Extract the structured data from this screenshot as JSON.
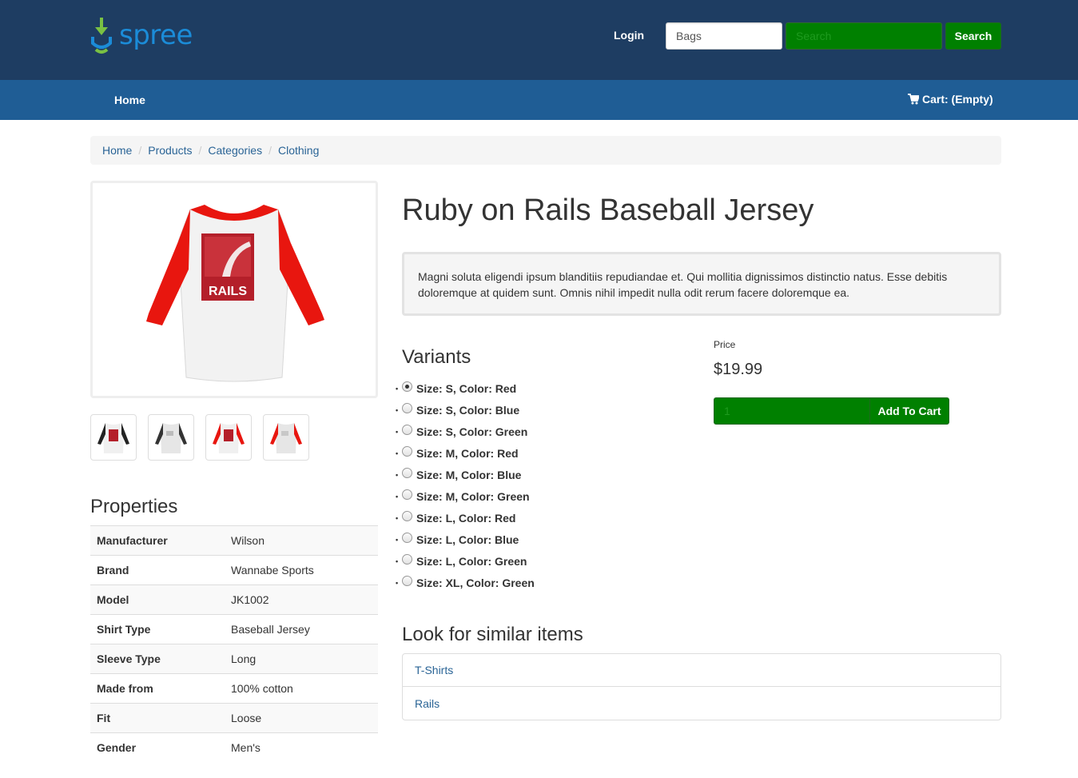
{
  "header": {
    "logo_text": "spree",
    "login_label": "Login",
    "taxon_select_value": "Bags",
    "search_placeholder": "Search",
    "search_button_label": "Search",
    "accent_color": "#008000",
    "header_color": "#1e3d62",
    "nav_color": "#1f5d95"
  },
  "nav": {
    "home_label": "Home",
    "cart_label": "Cart: (Empty)",
    "cart_icon": "cart-icon"
  },
  "breadcrumb": [
    "Home",
    "Products",
    "Categories",
    "Clothing"
  ],
  "product": {
    "title": "Ruby on Rails Baseball Jersey",
    "description": "Magni soluta eligendi ipsum blanditiis repudiandae et. Qui mollitia dignissimos distinctio natus. Esse debitis doloremque at quidem sunt. Omnis nihil impedit nulla odit rerum facere doloremque ea.",
    "image_logo_text": "RAILS"
  },
  "thumbnails": [
    {
      "sleeve_color": "#222222",
      "variant": "black"
    },
    {
      "sleeve_color": "#333333",
      "variant": "black-gray"
    },
    {
      "sleeve_color": "#e01010",
      "variant": "red"
    },
    {
      "sleeve_color": "#e01010",
      "variant": "red-gray"
    }
  ],
  "properties": {
    "title": "Properties",
    "rows": [
      {
        "key": "Manufacturer",
        "value": "Wilson"
      },
      {
        "key": "Brand",
        "value": "Wannabe Sports"
      },
      {
        "key": "Model",
        "value": "JK1002"
      },
      {
        "key": "Shirt Type",
        "value": "Baseball Jersey"
      },
      {
        "key": "Sleeve Type",
        "value": "Long"
      },
      {
        "key": "Made from",
        "value": "100% cotton"
      },
      {
        "key": "Fit",
        "value": "Loose"
      },
      {
        "key": "Gender",
        "value": "Men's"
      }
    ]
  },
  "variants": {
    "title": "Variants",
    "selected_index": 0,
    "items": [
      "Size: S, Color: Red",
      "Size: S, Color: Blue",
      "Size: S, Color: Green",
      "Size: M, Color: Red",
      "Size: M, Color: Blue",
      "Size: M, Color: Green",
      "Size: L, Color: Red",
      "Size: L, Color: Blue",
      "Size: L, Color: Green",
      "Size: XL, Color: Green"
    ]
  },
  "cart": {
    "price_label": "Price",
    "price": "$19.99",
    "quantity": "1",
    "add_to_cart_label": "Add To Cart"
  },
  "similar": {
    "title": "Look for similar items",
    "items": [
      "T-Shirts",
      "Rails"
    ]
  }
}
